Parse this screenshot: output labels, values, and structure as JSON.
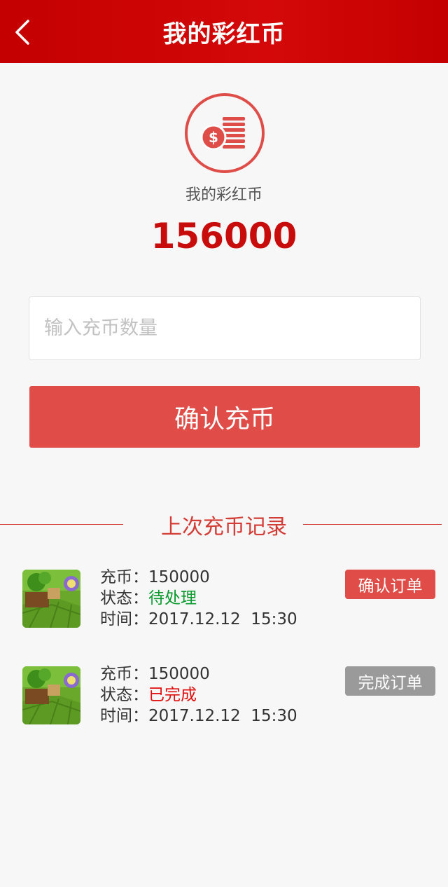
{
  "header": {
    "title": "我的彩红币",
    "back_icon": "chevron-left-icon"
  },
  "balance": {
    "label": "我的彩红币",
    "amount": "156000",
    "icon": "coins-icon"
  },
  "recharge": {
    "placeholder": "输入充币数量",
    "button_label": "确认充币"
  },
  "history": {
    "title": "上次充币记录",
    "records": [
      {
        "amount_label": "充币：",
        "amount": "150000",
        "status_label": "状态：",
        "status": "待处理",
        "time_label": "时间：",
        "time": "2017.12.12  15:30",
        "action": "确认订单"
      },
      {
        "amount_label": "充币：",
        "amount": "150000",
        "status_label": "状态：",
        "status": "已完成",
        "time_label": "时间：",
        "time": "2017.12.12  15:30",
        "action": "完成订单"
      }
    ]
  },
  "colors": {
    "brand_red": "#c40000",
    "accent": "#e04d48",
    "pending": "#0a9a2e",
    "done": "#e10c0c"
  }
}
